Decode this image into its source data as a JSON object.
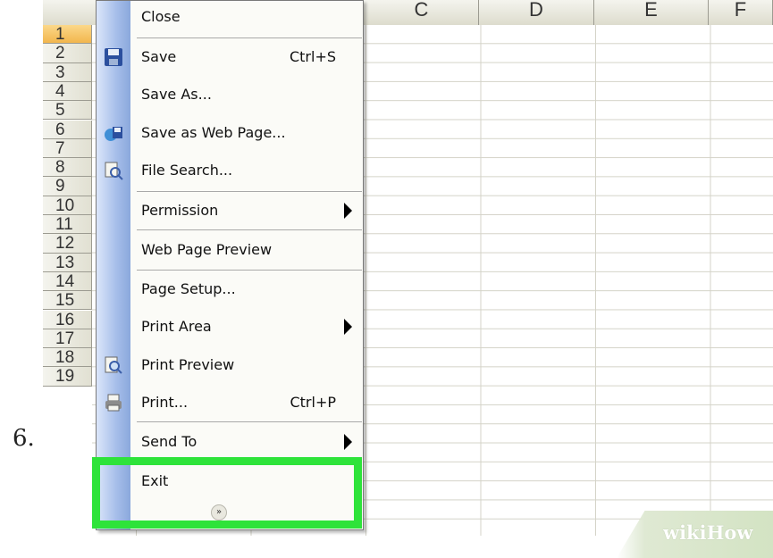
{
  "step_number": "6.",
  "columns": [
    "C",
    "D",
    "E",
    "F"
  ],
  "rows": [
    "1",
    "2",
    "3",
    "4",
    "5",
    "6",
    "7",
    "8",
    "9",
    "10",
    "11",
    "12",
    "13",
    "14",
    "15",
    "16",
    "17",
    "18",
    "19"
  ],
  "selected_row": "1",
  "menu": {
    "close": "Close",
    "save": "Save",
    "save_shortcut": "Ctrl+S",
    "save_as": "Save As...",
    "save_as_web_page": "Save as Web Page...",
    "file_search": "File Search...",
    "permission": "Permission",
    "web_page_preview": "Web Page Preview",
    "page_setup": "Page Setup...",
    "print_area": "Print Area",
    "print_preview": "Print Preview",
    "print": "Print...",
    "print_shortcut": "Ctrl+P",
    "send_to": "Send To",
    "exit": "Exit",
    "expand_chevron": "»"
  },
  "highlight_color": "#2ee33a",
  "menu_strip_color": "#a5bde9",
  "watermark": "wikiHow"
}
